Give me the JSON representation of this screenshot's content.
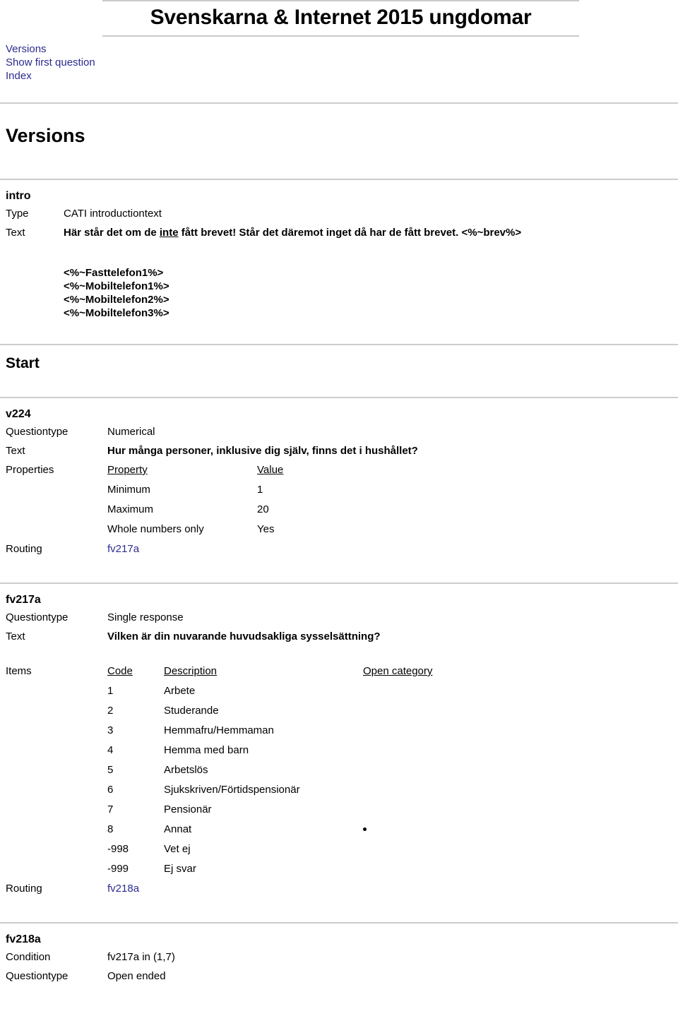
{
  "header": {
    "title": "Svenskarna & Internet 2015 ungdomar",
    "nav": [
      {
        "label": "Versions"
      },
      {
        "label": "Show first question"
      },
      {
        "label": "Index"
      }
    ]
  },
  "sections": [
    {
      "id": "versions",
      "heading": "Versions"
    },
    {
      "id": "start",
      "heading": "Start"
    }
  ],
  "labels": {
    "type": "Type",
    "text": "Text",
    "questiontype": "Questiontype",
    "properties": "Properties",
    "routing": "Routing",
    "items": "Items",
    "condition": "Condition"
  },
  "intro": {
    "name": "intro",
    "type_value": "CATI introductiontext",
    "text_before": "Här står det om de ",
    "text_underlined": "inte",
    "text_after": " fått brevet! Står det däremot inget då har de fått brevet. <%~brev%>",
    "placeholders": [
      "<%~Fasttelefon1%>",
      "<%~Mobiltelefon1%>",
      "<%~Mobiltelefon2%>",
      "<%~Mobiltelefon3%>"
    ]
  },
  "v224": {
    "name": "v224",
    "questiontype": "Numerical",
    "text": "Hur många personer, inklusive dig själv, finns det i hushållet?",
    "properties_headers": {
      "property": "Property",
      "value": "Value"
    },
    "properties_rows": [
      {
        "property": "Minimum",
        "value": "1"
      },
      {
        "property": "Maximum",
        "value": "20"
      },
      {
        "property": "Whole numbers only",
        "value": "Yes"
      }
    ],
    "routing": "fv217a"
  },
  "fv217a": {
    "name": "fv217a",
    "questiontype": "Single response",
    "text": "Vilken är din nuvarande huvudsakliga sysselsättning?",
    "items_headers": {
      "code": "Code",
      "description": "Description",
      "open_category": "Open category"
    },
    "items_rows": [
      {
        "code": "1",
        "description": "Arbete",
        "open": ""
      },
      {
        "code": "2",
        "description": "Studerande",
        "open": ""
      },
      {
        "code": "3",
        "description": "Hemmafru/Hemmaman",
        "open": ""
      },
      {
        "code": "4",
        "description": "Hemma med barn",
        "open": ""
      },
      {
        "code": "5",
        "description": "Arbetslös",
        "open": ""
      },
      {
        "code": "6",
        "description": "Sjukskriven/Förtidspensionär",
        "open": ""
      },
      {
        "code": "7",
        "description": "Pensionär",
        "open": ""
      },
      {
        "code": "8",
        "description": "Annat",
        "open": "dot"
      },
      {
        "code": "-998",
        "description": "Vet ej",
        "open": ""
      },
      {
        "code": "-999",
        "description": "Ej svar",
        "open": ""
      }
    ],
    "routing": "fv218a"
  },
  "fv218a": {
    "name": "fv218a",
    "condition": "fv217a in (1,7)",
    "questiontype": "Open ended"
  },
  "colors": {
    "link": "#2b2b8f",
    "rule": "#cccccc",
    "text": "#000000"
  }
}
